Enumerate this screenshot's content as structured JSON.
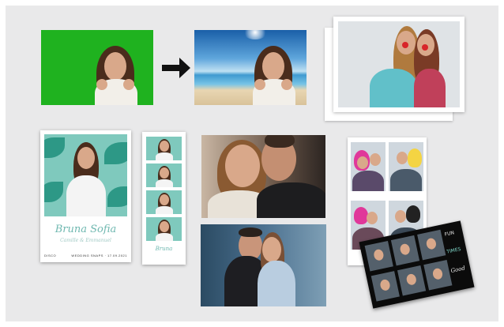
{
  "print": {
    "name": "Bruna Sofia",
    "subtitle": "Camille & Emmanuel",
    "footer_left": "DISCO",
    "footer_right": "WEDDING SNAPS · 17.09.2021"
  },
  "strip": {
    "script": "Bruna"
  },
  "tilted_card": {
    "line1": "FUN",
    "line2": "TIMES",
    "line3": "Good"
  },
  "colors": {
    "panel": "#e9e9ea",
    "green_screen": "#1fb21f",
    "teal_backdrop": "#7fc9bd",
    "leaf": "#1f8f7d",
    "script_text": "#6fb8b0"
  },
  "icons": [
    "right-arrow-icon"
  ]
}
